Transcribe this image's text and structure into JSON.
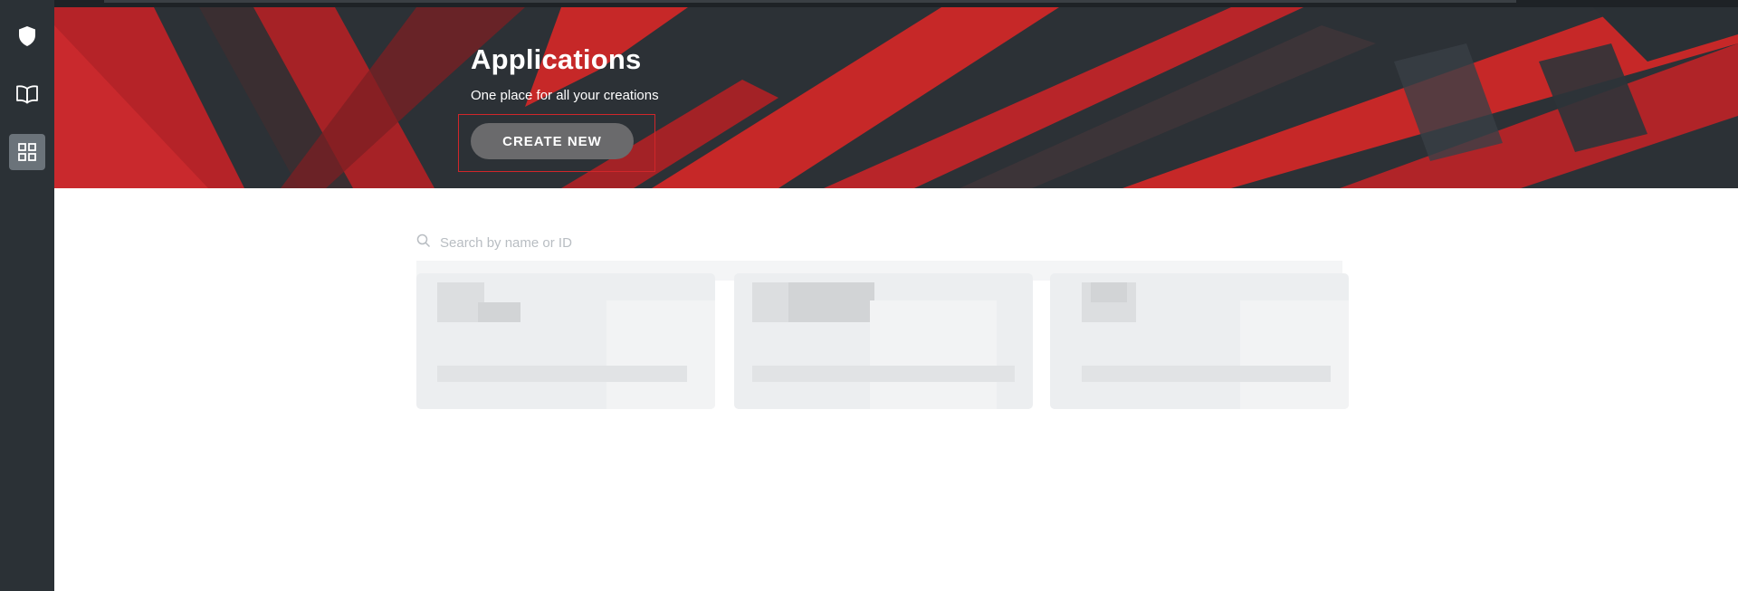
{
  "sidebar": {
    "items": [
      {
        "icon": "shield-icon",
        "active": false
      },
      {
        "icon": "book-icon",
        "active": false
      },
      {
        "icon": "grid-icon",
        "active": true
      }
    ]
  },
  "hero": {
    "title": "Applications",
    "subtitle": "One place for all your creations",
    "create_button": "CREATE NEW"
  },
  "search": {
    "placeholder": "Search by name or ID"
  },
  "colors": {
    "sidebar_bg": "#2b3136",
    "hero_dark": "#2c3136",
    "hero_red": "#c62828",
    "button_bg": "#6a6a6c",
    "highlight": "#d0262a"
  },
  "cards": [
    {
      "state": "loading"
    },
    {
      "state": "loading"
    },
    {
      "state": "loading"
    }
  ]
}
